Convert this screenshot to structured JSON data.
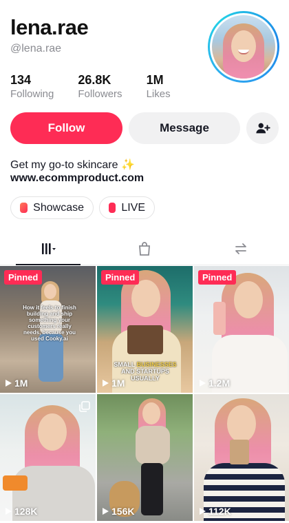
{
  "profile": {
    "display_name": "lena.rae",
    "handle": "@lena.rae",
    "stats": [
      {
        "value": "134",
        "label": "Following"
      },
      {
        "value": "26.8K",
        "label": "Followers"
      },
      {
        "value": "1M",
        "label": "Likes"
      }
    ],
    "bio_line": "Get my go-to skincare ✨",
    "bio_link": "www.ecommproduct.com"
  },
  "actions": {
    "follow_label": "Follow",
    "message_label": "Message",
    "add_friend_icon": "add-person-icon"
  },
  "chips": [
    {
      "label": "Showcase",
      "icon": "showcase-icon"
    },
    {
      "label": "LIVE",
      "icon": "live-icon"
    }
  ],
  "tabs": [
    {
      "icon": "grid-videos-icon",
      "active": true
    },
    {
      "icon": "shopping-bag-icon",
      "active": false
    },
    {
      "icon": "repost-icon",
      "active": false
    }
  ],
  "videos": [
    {
      "pinned": "Pinned",
      "views": "1M",
      "caption": "How it feels to finish building and ship something your customers really needs, because you used Cooky.ai"
    },
    {
      "pinned": "Pinned",
      "views": "1M",
      "caption_pre": "SMALL ",
      "caption_hl": "BUSINESSES",
      "caption_post": " AND STARTUPS USUALLY"
    },
    {
      "pinned": "Pinned",
      "views": "1.2M"
    },
    {
      "views": "128K",
      "multi_photo": true
    },
    {
      "views": "156K"
    },
    {
      "views": "112K"
    }
  ],
  "colors": {
    "accent": "#fe2c55",
    "secondary_button": "#f1f1f2",
    "muted_text": "#8a8b91",
    "avatar_ring": "#2fa7f0"
  }
}
